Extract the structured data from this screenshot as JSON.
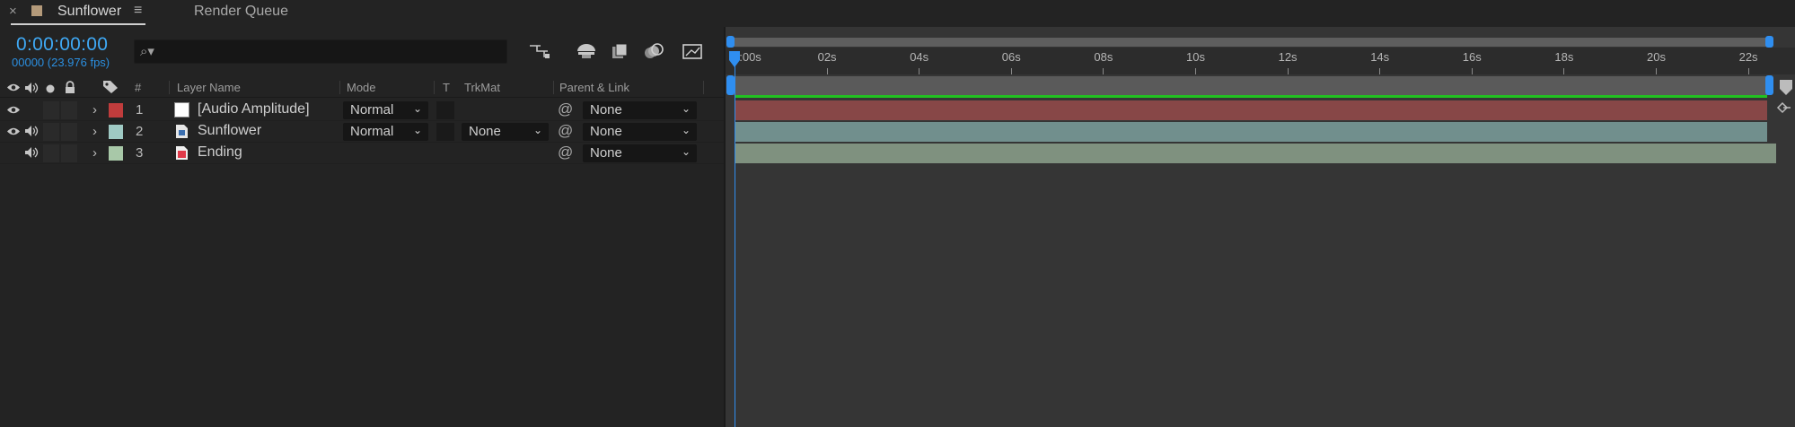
{
  "tabs": [
    {
      "title": "Sunflower",
      "close": "×",
      "menu": "≡"
    },
    {
      "title": "Render Queue"
    }
  ],
  "composition": {
    "timecode": "0:00:00:00",
    "frame_fps": "00000 (23.976 fps)"
  },
  "search": {
    "placeholder": ""
  },
  "columns": {
    "number": "#",
    "layer_name": "Layer Name",
    "mode": "Mode",
    "t": "T",
    "trkmat": "TrkMat",
    "parent_link": "Parent & Link"
  },
  "layers": [
    {
      "num": "1",
      "name": "[Audio Amplitude]",
      "mode": "Normal",
      "trkmat": "",
      "parent": "None",
      "label_color": "#c03c3c",
      "icon": "solid-icon",
      "video": true,
      "audio": false
    },
    {
      "num": "2",
      "name": "Sunflower",
      "mode": "Normal",
      "trkmat": "None",
      "parent": "None",
      "label_color": "#9fcac4",
      "icon": "footage-icon",
      "video": true,
      "audio": true
    },
    {
      "num": "3",
      "name": "Ending",
      "mode": "",
      "trkmat": "",
      "parent": "None",
      "label_color": "#a8c8a8",
      "icon": "audio-file-icon",
      "video": false,
      "audio": true
    }
  ],
  "ruler": {
    "labels": [
      "0:00s",
      "02s",
      "04s",
      "06s",
      "08s",
      "10s",
      "12s",
      "14s",
      "16s",
      "18s",
      "20s",
      "22s"
    ]
  },
  "colors": {
    "accent": "#2f8ef0",
    "timecode": "#3fa9f5",
    "bar1": "#874747",
    "bar2": "#718f8d",
    "bar3": "#7f917f",
    "audio_marker": "#21c121"
  }
}
